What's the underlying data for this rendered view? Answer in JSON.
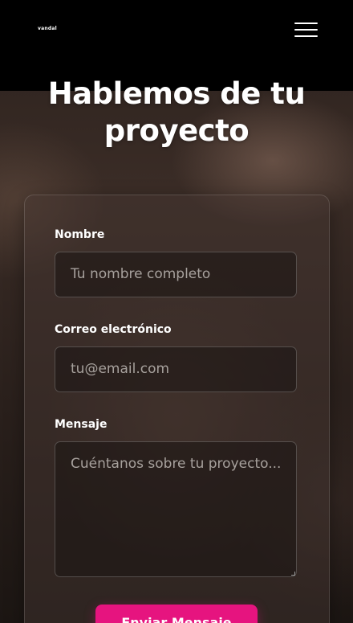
{
  "header": {
    "logo_text": "vandal",
    "menu_icon": "hamburger-menu-icon"
  },
  "hero": {
    "title_line1": "Hablemos de tu",
    "title_line2": "proyecto"
  },
  "form": {
    "name": {
      "label": "Nombre",
      "placeholder": "Tu nombre completo"
    },
    "email": {
      "label": "Correo electrónico",
      "placeholder": "tu@email.com"
    },
    "message": {
      "label": "Mensaje",
      "placeholder": "Cuéntanos sobre tu proyecto..."
    },
    "submit_label": "Enviar Mensaje"
  },
  "colors": {
    "accent": "#e6147f",
    "header_bg": "#000000"
  }
}
